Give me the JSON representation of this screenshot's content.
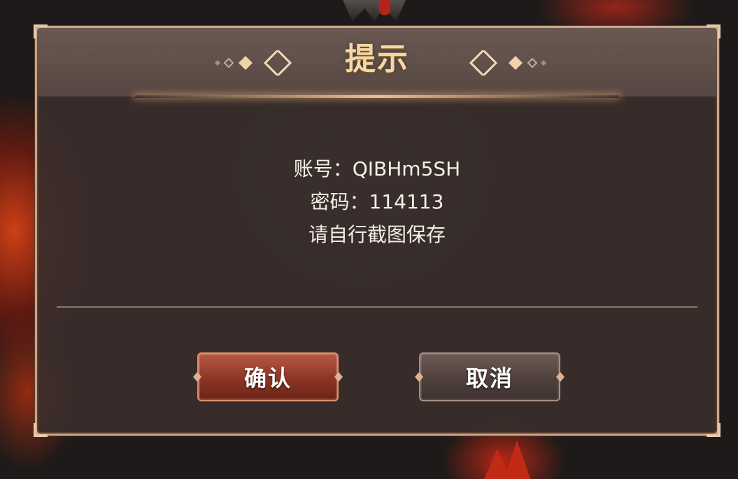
{
  "dialog": {
    "title": "提示",
    "message_lines": [
      "账号：QIBHm5SH",
      "密码：114113",
      "请自行截图保存"
    ],
    "confirm_label": "确认",
    "cancel_label": "取消"
  },
  "colors": {
    "title": "#f3d8a6",
    "frame_border": "#c9a585",
    "confirm_button": "#8a3424",
    "cancel_button": "#4f403c",
    "text": "#f4efe9"
  },
  "icons": {
    "title_decoration_left": "diamond-ornament-icon",
    "title_decoration_right": "diamond-ornament-icon"
  }
}
